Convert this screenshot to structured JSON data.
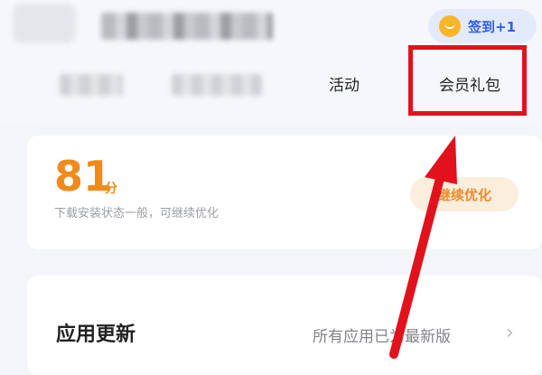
{
  "header": {
    "signin": {
      "label": "签到+1",
      "icon": "coin-icon",
      "accent": "#2f5fe8"
    },
    "tabs": [
      {
        "label": "活动"
      },
      {
        "label": "会员礼包"
      }
    ]
  },
  "score_card": {
    "score": "81",
    "unit": "分",
    "description": "下载安装状态一般，可继续优化",
    "button_label": "继续优化",
    "accent": "#f08a1c"
  },
  "update_card": {
    "title": "应用更新",
    "status": "所有应用已为最新版",
    "icon": "chevron-right-icon"
  },
  "annotation": {
    "color": "#e1121c"
  }
}
